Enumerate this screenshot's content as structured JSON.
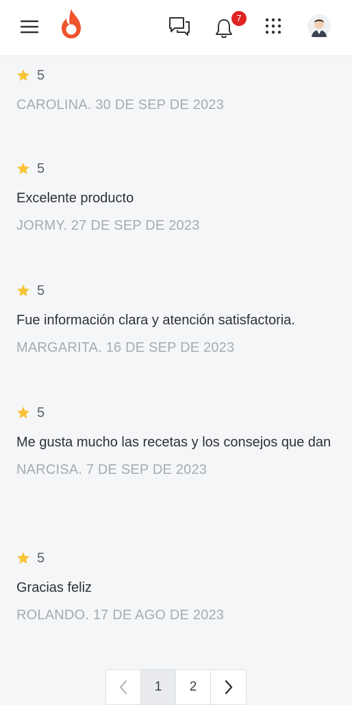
{
  "header": {
    "notifications_count": "7",
    "icons": {
      "menu": "hamburger-icon",
      "logo": "flame-logo",
      "chat": "chat-icon",
      "notifications": "bell-icon",
      "apps": "grid-icon",
      "avatar": "user-avatar"
    },
    "brand_color": "#f0542d"
  },
  "reviews": [
    {
      "rating": "5",
      "comment": "",
      "meta": "CAROLINA. 30 DE SEP DE 2023"
    },
    {
      "rating": "5",
      "comment": "Excelente producto",
      "meta": "JORMY. 27 DE SEP DE 2023"
    },
    {
      "rating": "5",
      "comment": "Fue información clara y atención satisfactoria.",
      "meta": "MARGARITA. 16 DE SEP DE 2023"
    },
    {
      "rating": "5",
      "comment": "Me gusta mucho las recetas y los consejos que dan",
      "meta": "NARCISA. 7 DE SEP DE 2023"
    },
    {
      "rating": "5",
      "comment": "Gracias feliz",
      "meta": "ROLANDO. 17 DE AGO DE 2023"
    }
  ],
  "pagination": {
    "pages": [
      "1",
      "2"
    ],
    "current": "1",
    "prev_icon": "chevron-left-icon",
    "next_icon": "chevron-right-icon"
  },
  "colors": {
    "star": "#f7c437",
    "meta_text": "#a5abb2",
    "badge": "#e02424"
  }
}
